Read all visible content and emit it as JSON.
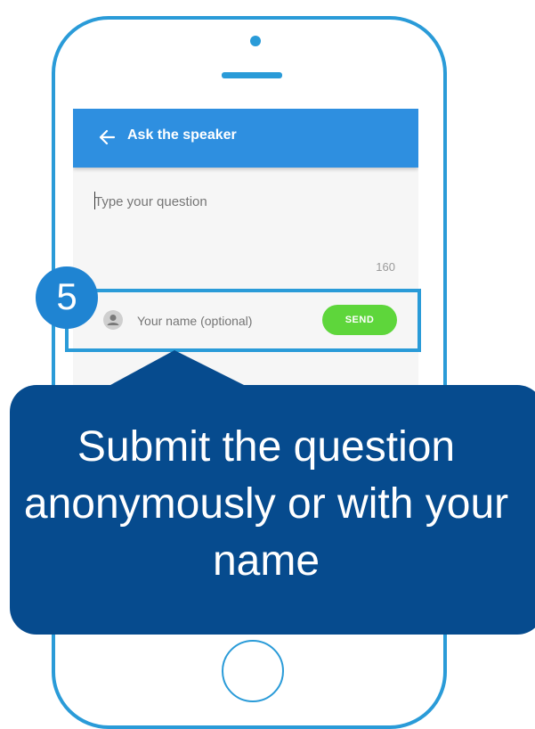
{
  "app": {
    "header_title": "Ask the speaker",
    "back_icon": "arrow-left-icon",
    "question_placeholder": "Type your question",
    "char_count": "160",
    "name_placeholder": "Your name (optional)",
    "avatar_icon": "person-icon",
    "send_label": "SEND"
  },
  "annotation": {
    "step_number": "5",
    "callout_text": "Submit the question anonymously or with your name"
  },
  "colors": {
    "phone_outline": "#2a9bd8",
    "header": "#2e8fe0",
    "send_button": "#5ed63b",
    "callout": "#064b8e",
    "step_badge": "#1f84d2"
  }
}
